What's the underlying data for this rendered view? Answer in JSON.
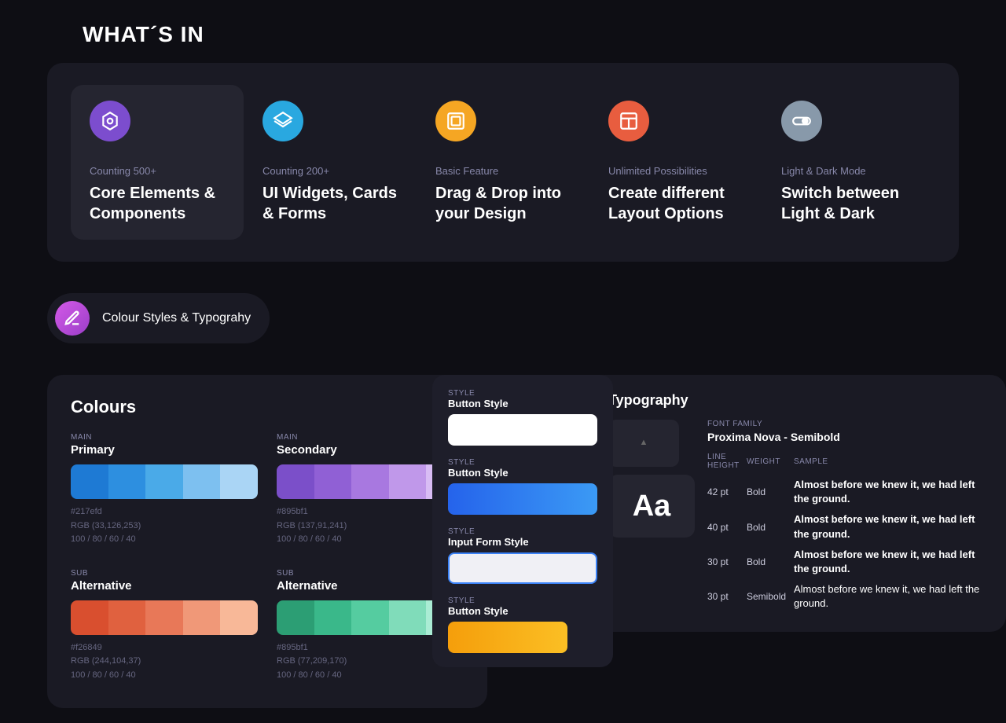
{
  "header": {
    "title": "WHAT´S IN"
  },
  "features": {
    "items": [
      {
        "id": "core-elements",
        "subtitle": "Counting 500+",
        "title": "Core Elements & Components",
        "icon_type": "hexagon",
        "icon_color": "purple",
        "highlighted": true
      },
      {
        "id": "ui-widgets",
        "subtitle": "Counting 200+",
        "title": "UI Widgets, Cards & Forms",
        "icon_type": "layers",
        "icon_color": "blue",
        "highlighted": false
      },
      {
        "id": "drag-drop",
        "subtitle": "Basic Feature",
        "title": "Drag & Drop into your Design",
        "icon_type": "frame",
        "icon_color": "orange",
        "highlighted": false
      },
      {
        "id": "layout",
        "subtitle": "Unlimited Possibilities",
        "title": "Create different Layout Options",
        "icon_type": "layout",
        "icon_color": "red",
        "highlighted": false
      },
      {
        "id": "dark-mode",
        "subtitle": "Light & Dark Mode",
        "title": "Switch between Light & Dark",
        "icon_type": "toggle",
        "icon_color": "gray",
        "highlighted": false
      }
    ]
  },
  "section_badge": {
    "label": "Colour Styles & Typograhy",
    "icon": "pen"
  },
  "colours": {
    "title": "Colours",
    "main": {
      "tag": "MAIN",
      "primary": {
        "name": "Primary",
        "hex": "#217efd",
        "rgb": "RGB (33,126,253)",
        "opacity": "100 / 80 / 60 / 40"
      },
      "secondary": {
        "name": "Secondary",
        "hex": "#895bf1",
        "rgb": "RGB (137,91,241)",
        "opacity": "100 / 80 / 60 / 40"
      }
    },
    "sub": {
      "tag": "SUB",
      "alt_left": {
        "name": "Alternative",
        "hex": "#f26849",
        "rgb": "RGB (244,104,37)",
        "opacity": "100 / 80 / 60 / 40"
      },
      "alt_right": {
        "name": "Alternative",
        "hex": "#895bf1",
        "rgb": "RGB (77,209,170)",
        "opacity": "100 / 80 / 60 / 40"
      }
    }
  },
  "typography": {
    "title": "Typography",
    "aa_label": "Aa",
    "font_family_label": "FONT FAMILY",
    "font_family": "Proxima Nova - Semibold",
    "table": {
      "headers": [
        "LINE HEIGHT",
        "WEIGHT",
        "SAMPLE"
      ],
      "rows": [
        {
          "size": "42 pt",
          "weight": "Bold",
          "sample": "Almost before we knew it, we had left the ground.",
          "is_bold": true
        },
        {
          "size": "40 pt",
          "weight": "Bold",
          "sample": "Almost before we knew it, we had left the ground.",
          "is_bold": true
        },
        {
          "size": "30 pt",
          "weight": "Bold",
          "sample": "Almost before we knew it, we had left the ground.",
          "is_bold": true
        },
        {
          "size": "30 pt",
          "weight": "Semibold",
          "sample": "Almost before we knew it, we had left the ground.",
          "is_bold": false
        }
      ]
    }
  },
  "styles": {
    "items": [
      {
        "tag": "STYLE",
        "name": "Button Style",
        "type": "button-blue"
      },
      {
        "tag": "STYLE",
        "name": "Input Form Style",
        "type": "input"
      },
      {
        "tag": "STYLE",
        "name": "Button Style",
        "type": "button-orange"
      }
    ]
  }
}
